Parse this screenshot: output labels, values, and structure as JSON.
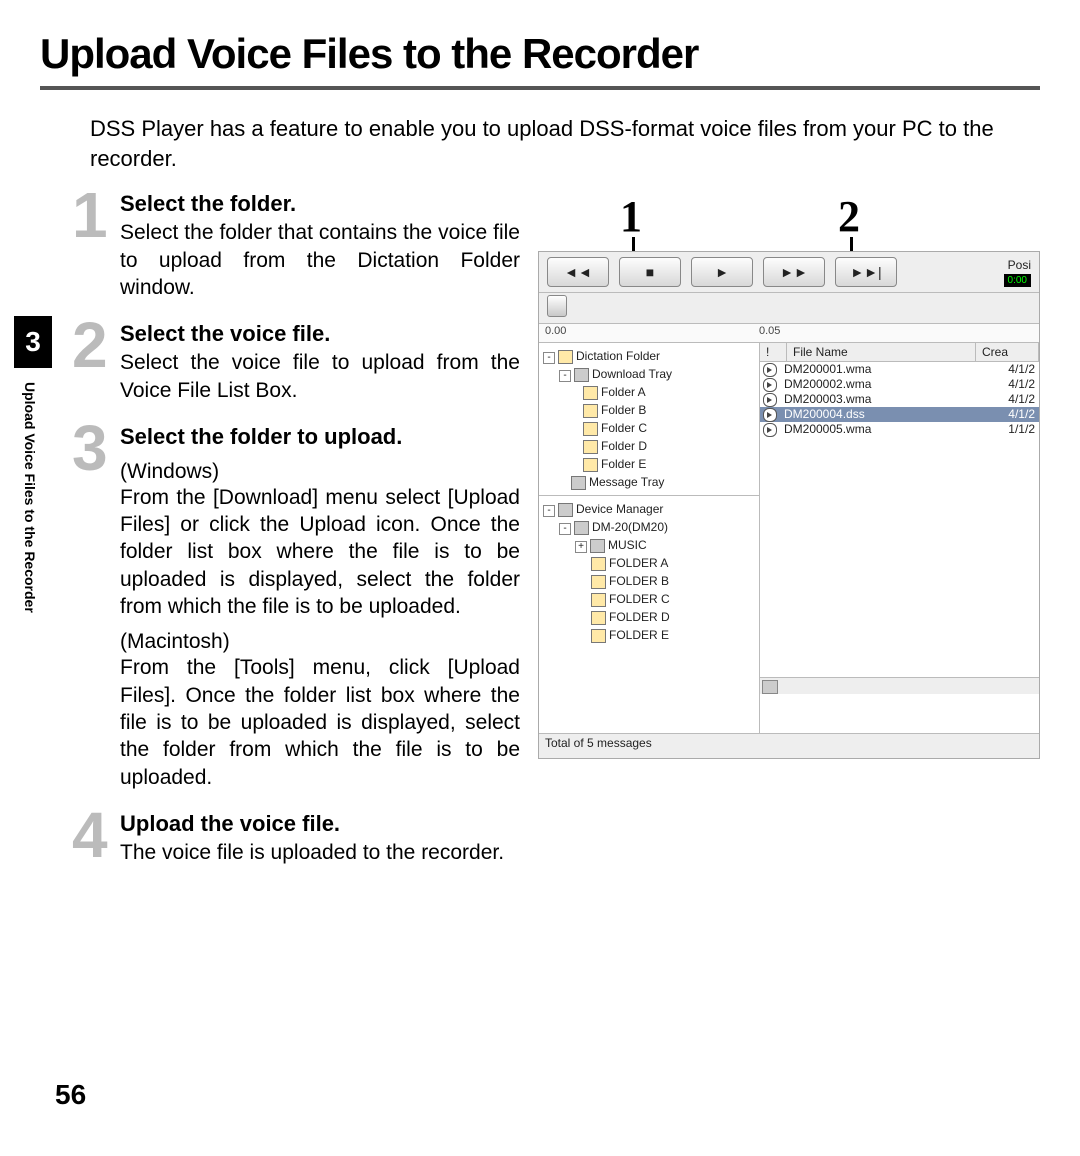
{
  "title": "Upload Voice Files to the Recorder",
  "intro": "DSS Player has a feature to enable you to upload DSS-format voice files from your PC to the recorder.",
  "sidebar_chapter": "3",
  "sidebar_running": "Upload Voice Files to the Recorder",
  "page_number": "56",
  "steps": [
    {
      "num": "1",
      "title": "Select the folder.",
      "body": "Select the folder that contains the voice file to upload from the Dictation Folder window."
    },
    {
      "num": "2",
      "title": "Select the voice file.",
      "body": "Select the voice file to upload from the Voice File List Box."
    },
    {
      "num": "3",
      "title": "Select the folder to upload.",
      "platform1": "(Windows)",
      "body1": "From the [Download] menu select [Upload Files] or click the Upload icon. Once the folder list box where the file is to be uploaded is displayed, select the folder from which the file is to be uploaded.",
      "platform2": "(Macintosh)",
      "body2": "From the [Tools] menu, click [Upload Files]. Once the folder list box where the file is to be uploaded is displayed, select the folder from which the file is to be uploaded."
    },
    {
      "num": "4",
      "title": "Upload the voice file.",
      "body": "The voice file is uploaded to the recorder."
    }
  ],
  "callout_numbers": [
    "1",
    "2"
  ],
  "screenshot": {
    "position_label": "Posi",
    "position_value": "0:00",
    "ruler": [
      "0.00",
      "0.05"
    ],
    "tree1": {
      "root": "Dictation Folder",
      "items": [
        "Download Tray",
        "Folder A",
        "Folder B",
        "Folder C",
        "Folder D",
        "Folder E",
        "Message Tray"
      ]
    },
    "tree2": {
      "root": "Device Manager",
      "device": "DM-20(DM20)",
      "music": "MUSIC",
      "items": [
        "FOLDER A",
        "FOLDER B",
        "FOLDER C",
        "FOLDER D",
        "FOLDER E"
      ]
    },
    "list_headers": [
      "!",
      "File Name",
      "Crea"
    ],
    "files": [
      {
        "name": "DM200001.wma",
        "date": "4/1/2"
      },
      {
        "name": "DM200002.wma",
        "date": "4/1/2"
      },
      {
        "name": "DM200003.wma",
        "date": "4/1/2"
      },
      {
        "name": "DM200004.dss",
        "date": "4/1/2",
        "selected": true
      },
      {
        "name": "DM200005.wma",
        "date": "1/1/2"
      }
    ],
    "status": "Total of 5 messages"
  }
}
